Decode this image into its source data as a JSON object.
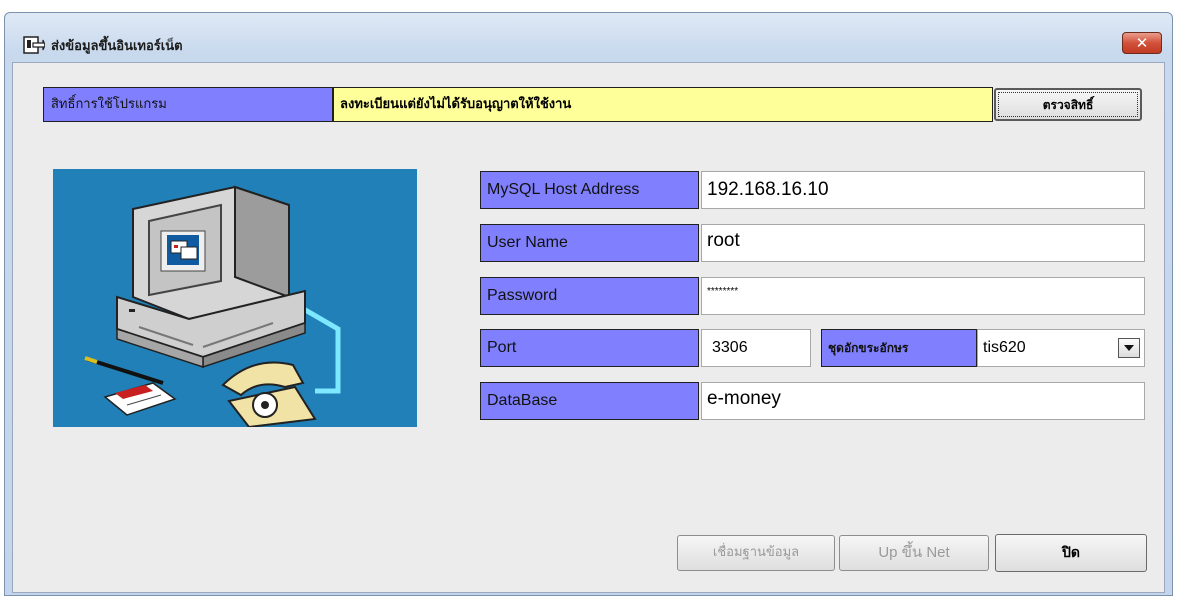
{
  "window": {
    "title": "ส่งข้อมูลขึ้นอินเทอร์เน็ต",
    "close_symbol": "✕"
  },
  "license": {
    "label": "สิทธิ์การใช้โปรแกรม",
    "status": "ลงทะเบียนแต่ยังไม่ได้รับอนุญาตให้ใช้งาน",
    "check_button": "ตรวจสิทธิ์",
    "status_color": "#ffff99"
  },
  "form": {
    "host_label": "MySQL Host Address",
    "host_value": "192.168.16.10",
    "user_label": "User Name",
    "user_value": "root",
    "password_label": "Password",
    "password_value": "********",
    "port_label": "Port",
    "port_value": "3306",
    "charset_label": "ชุดอักขระอักษร",
    "charset_value": "tis620",
    "database_label": "DataBase",
    "database_value": "e-money"
  },
  "buttons": {
    "connect": "เชื่อมฐานข้อมูล",
    "upload": "Up ขึ้น Net",
    "close": "ปิด"
  },
  "colors": {
    "label_bg": "#8080ff",
    "illustration_bg": "#2180b7"
  },
  "icons": {
    "app": "window-arrow-icon",
    "dropdown": "triangle-down-icon"
  }
}
